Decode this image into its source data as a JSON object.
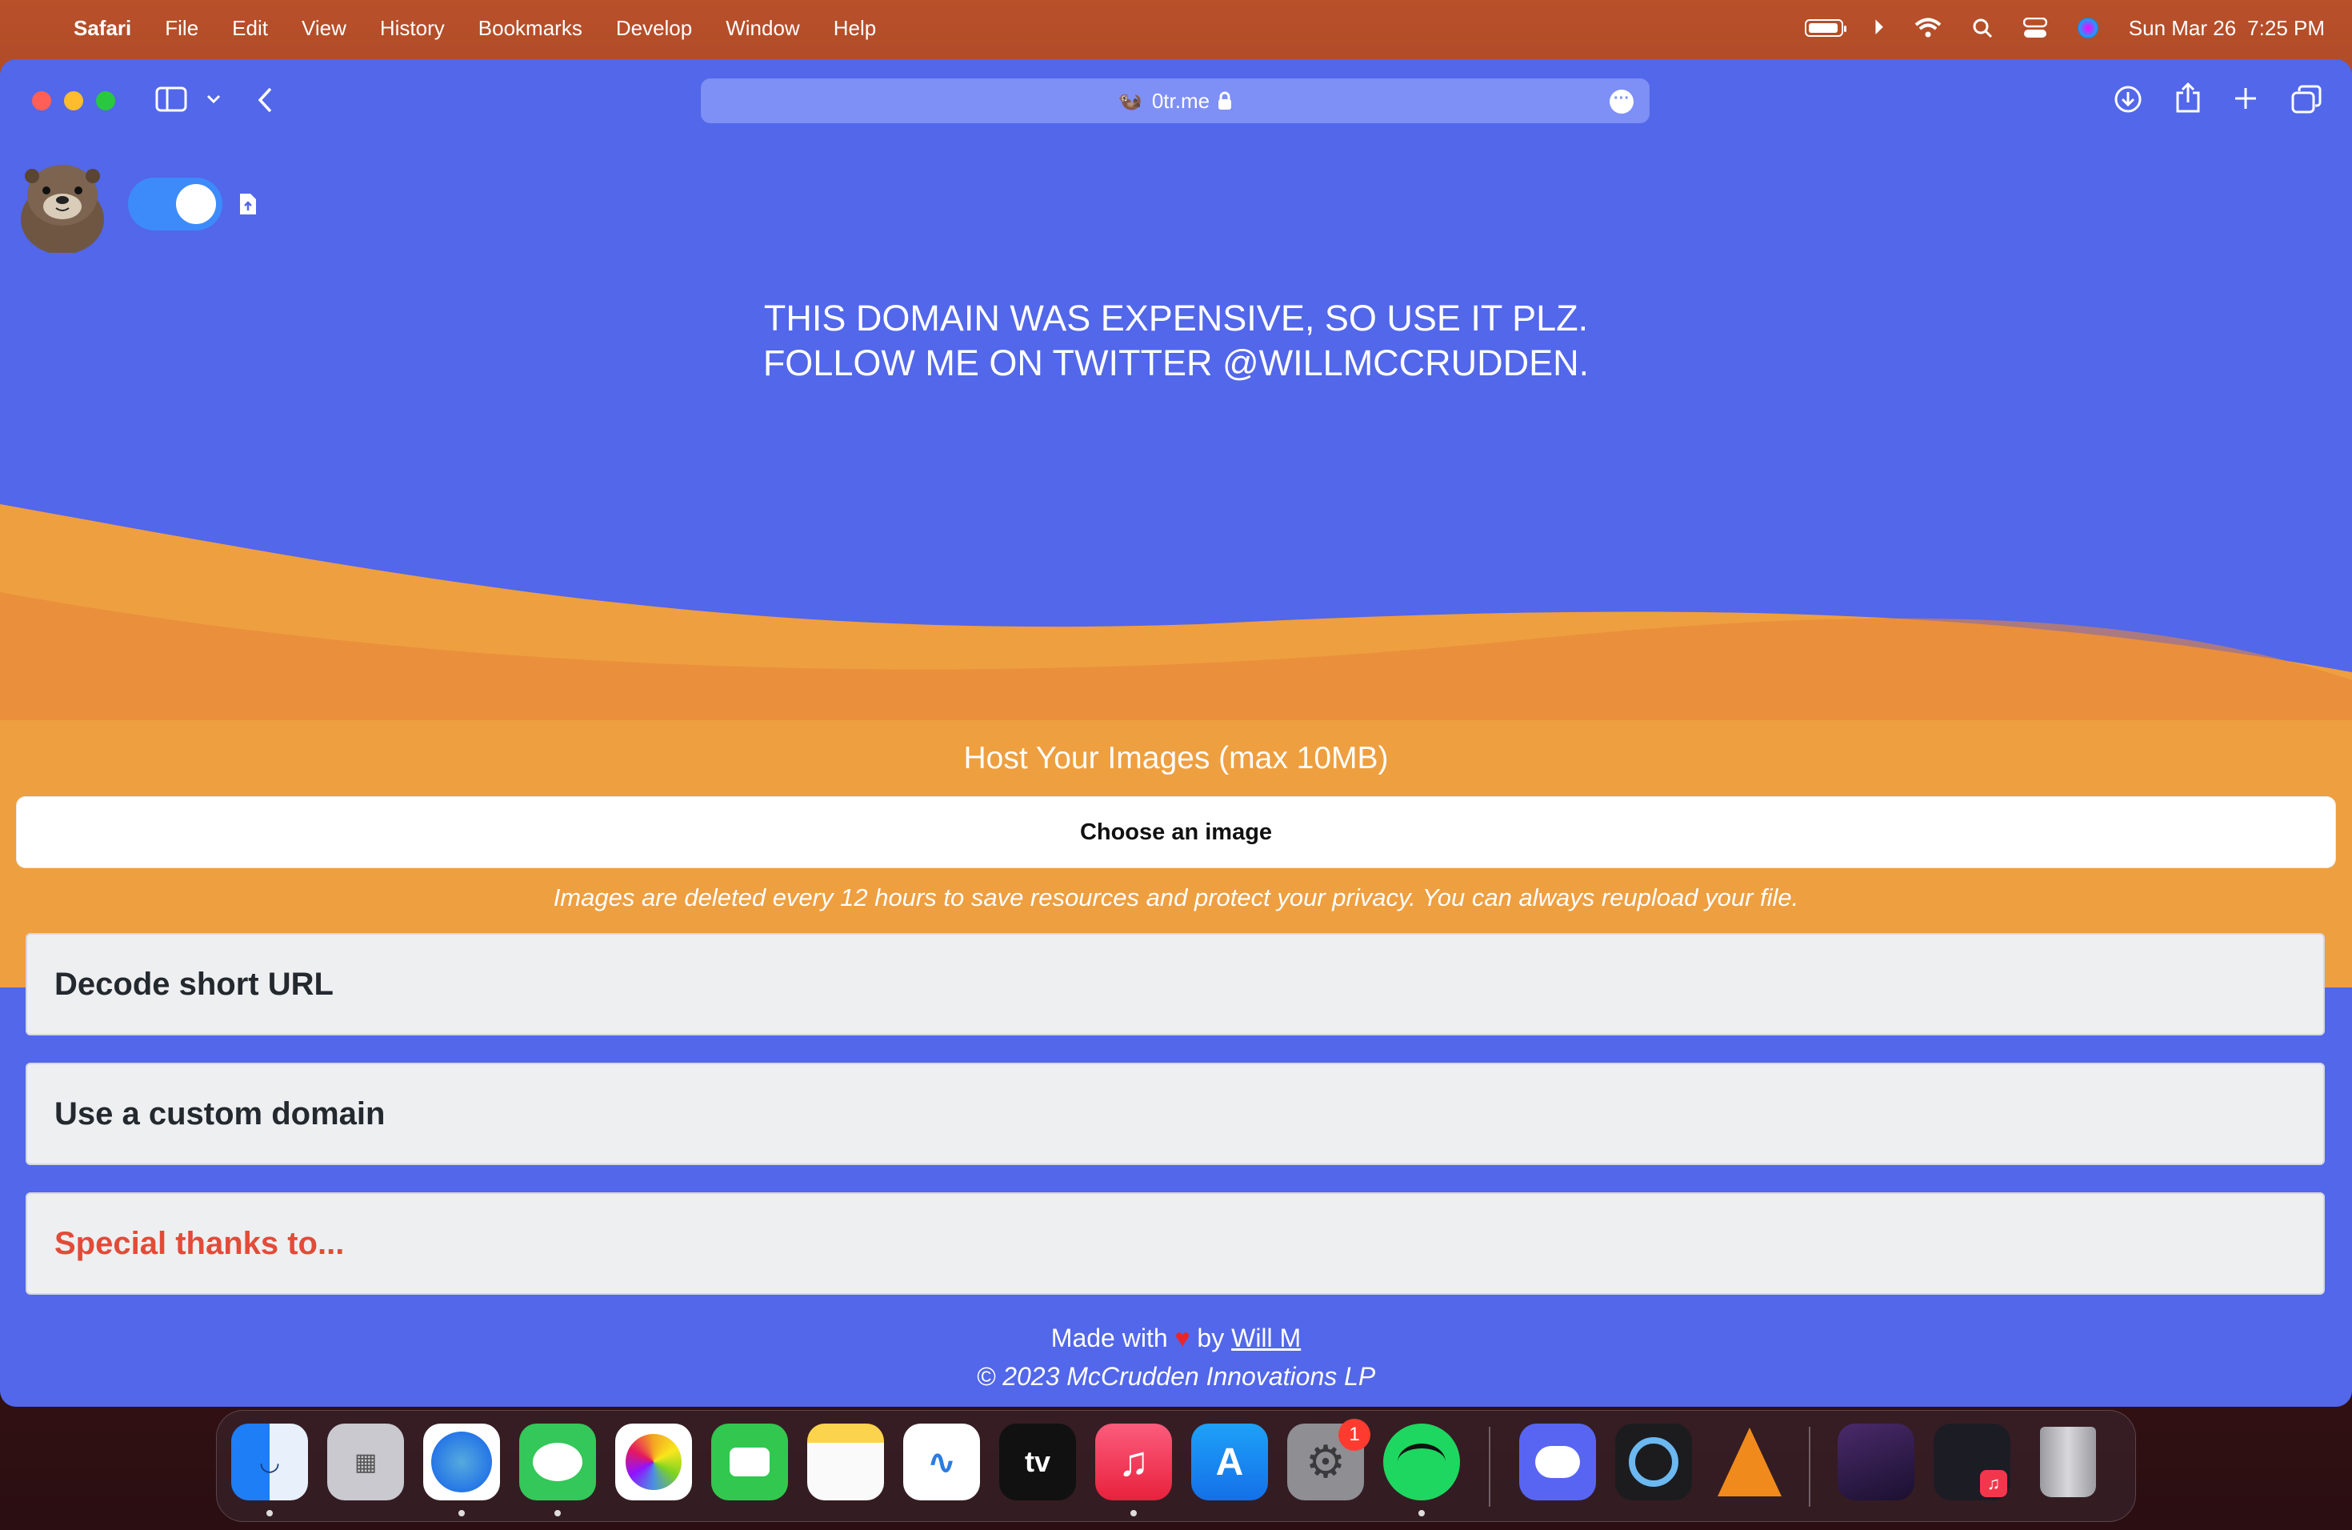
{
  "menubar": {
    "app": "Safari",
    "items": [
      "File",
      "Edit",
      "View",
      "History",
      "Bookmarks",
      "Develop",
      "Window",
      "Help"
    ],
    "date": "Sun Mar 26",
    "time": "7:25 PM"
  },
  "browser": {
    "url": "0tr.me"
  },
  "page": {
    "tagline_line1": "THIS DOMAIN WAS EXPENSIVE, SO USE IT PLZ.",
    "tagline_line2": "FOLLOW ME ON TWITTER @WILLMCCRUDDEN.",
    "toggle_on": true,
    "upload_title": "Host Your Images (max 10MB)",
    "choose_label": "Choose an image",
    "upload_note": "Images are deleted every 12 hours to save resources and protect your privacy. You can always reupload your file.",
    "accordions": [
      "Decode short URL",
      "Use a custom domain",
      "Special thanks to..."
    ],
    "footer": {
      "made_with": "Made with",
      "by": "by",
      "author": "Will M",
      "copyright": "© 2023 McCrudden Innovations LP"
    }
  },
  "colors": {
    "page_bg": "#5267e9",
    "wave_orange": "#ee9f40",
    "thanks_red": "#e24b38",
    "toggle_blue": "#3d8bfb"
  },
  "dock": {
    "apps": [
      "Finder",
      "Launchpad",
      "Safari",
      "Messages",
      "Photos",
      "FaceTime",
      "Notes",
      "Freeform",
      "TV",
      "Music",
      "App Store",
      "System Settings",
      "Spotify",
      "Discord",
      "QuickTime Player",
      "VLC",
      "Window 1",
      "Window 2",
      "Trash"
    ],
    "tv_label": "tv",
    "settings_badge": "1"
  }
}
